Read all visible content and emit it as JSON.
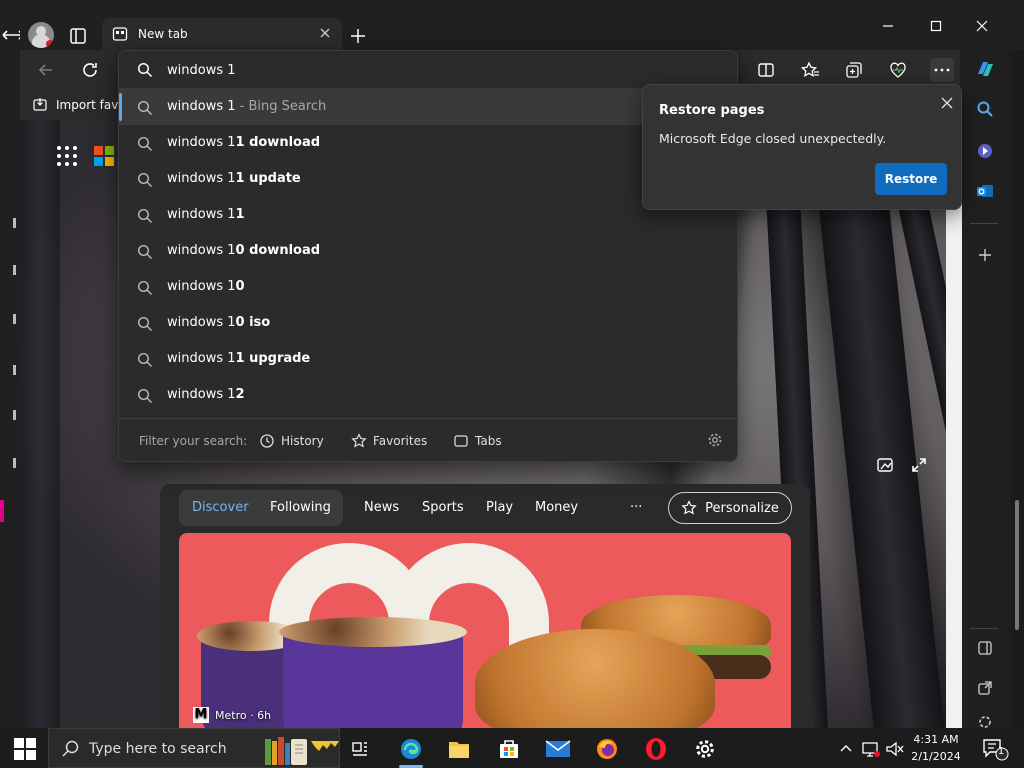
{
  "tab": {
    "title": "New tab"
  },
  "favorites_bar": {
    "import_label": "Import favo"
  },
  "search": {
    "query": "windows 1",
    "suggestions": [
      {
        "typed": "windows 1",
        "completion": "",
        "source": " - Bing Search"
      },
      {
        "typed": "windows 1",
        "completion": "1 download",
        "source": ""
      },
      {
        "typed": "windows 1",
        "completion": "1 update",
        "source": ""
      },
      {
        "typed": "windows 1",
        "completion": "1",
        "source": ""
      },
      {
        "typed": "windows 1",
        "completion": "0 download",
        "source": ""
      },
      {
        "typed": "windows 1",
        "completion": "0",
        "source": ""
      },
      {
        "typed": "windows 1",
        "completion": "0 iso",
        "source": ""
      },
      {
        "typed": "windows 1",
        "completion": "1 upgrade",
        "source": ""
      },
      {
        "typed": "windows 1",
        "completion": "2",
        "source": ""
      }
    ],
    "filter_label": "Filter your search:",
    "filters": [
      "History",
      "Favorites",
      "Tabs"
    ]
  },
  "restore": {
    "title": "Restore pages",
    "message": "Microsoft Edge closed unexpectedly.",
    "button": "Restore"
  },
  "feed": {
    "nav": [
      "Discover",
      "Following",
      "News",
      "Sports",
      "Play",
      "Money"
    ],
    "more": "···",
    "personalize": "Personalize",
    "card_source": "Metro · 6h",
    "card_source_logo": "M"
  },
  "taskbar": {
    "search_placeholder": "Type here to search",
    "time": "4:31 AM",
    "date": "2/1/2024",
    "notification_count": "1"
  },
  "colors": {
    "accent": "#0f6cbd",
    "link": "#73b6f5",
    "card_bg": "#ec5a5c"
  }
}
